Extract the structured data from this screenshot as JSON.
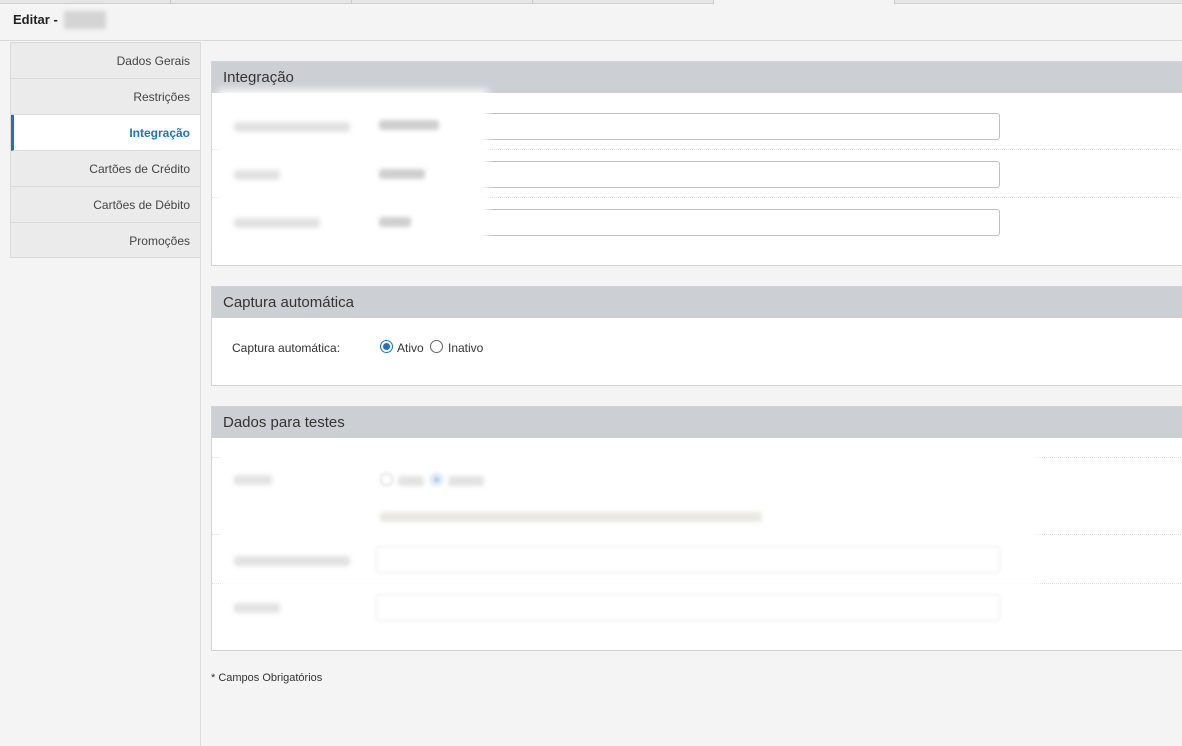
{
  "page": {
    "title": "Editar -",
    "footnote": "* Campos Obrigatórios"
  },
  "sidebar": {
    "items": [
      {
        "label": "Dados Gerais",
        "active": false
      },
      {
        "label": "Restrições",
        "active": false
      },
      {
        "label": "Integração",
        "active": true
      },
      {
        "label": "Cartões de Crédito",
        "active": false
      },
      {
        "label": "Cartões de Débito",
        "active": false
      },
      {
        "label": "Promoções",
        "active": false
      }
    ]
  },
  "integracao": {
    "header": "Integração",
    "fields": [
      "",
      "",
      ""
    ]
  },
  "captura": {
    "header": "Captura automática",
    "label": "Captura automática:",
    "options": [
      {
        "label": "Ativo",
        "checked": true
      },
      {
        "label": "Inativo",
        "checked": false
      }
    ]
  },
  "testes": {
    "header": "Dados para testes"
  },
  "colors": {
    "accent": "#1a73c8",
    "panel_header": "#ccd0d5"
  }
}
